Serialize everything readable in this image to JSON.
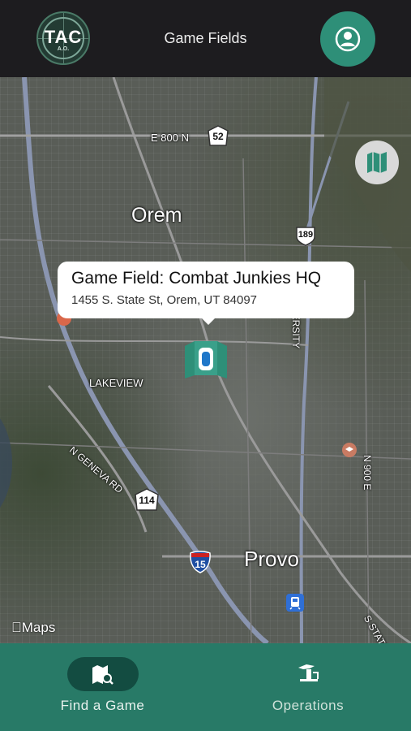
{
  "header": {
    "title": "Game Fields",
    "logo_text": "TAC",
    "logo_subtext": "A.O."
  },
  "map": {
    "labels": {
      "orem": "Orem",
      "provo": "Provo",
      "lakeview": "LAKEVIEW",
      "e800n": "E 800 N",
      "ngeneva": "N GENEVA RD",
      "nuniversity": "N UNIVERSITY",
      "n900e": "N 900 E",
      "s_state": "S STATE"
    },
    "shields": {
      "sr52": "52",
      "us189": "189",
      "sr114": "114",
      "i15": "15"
    },
    "callout": {
      "title": "Game Field: Combat Junkies HQ",
      "address": "1455 S. State St, Orem, UT 84097"
    },
    "attribution": "Maps",
    "icons": [
      "map-layers-icon",
      "game-field-pin-icon",
      "school-poi-icon",
      "transit-poi-icon"
    ]
  },
  "tabbar": {
    "find_label": "Find a Game",
    "ops_label": "Operations"
  },
  "colors": {
    "header_bg": "#1d1c1f",
    "accent": "#2e8f78",
    "tabbar_bg": "#287a67",
    "tab_active_pill": "#134c41"
  }
}
